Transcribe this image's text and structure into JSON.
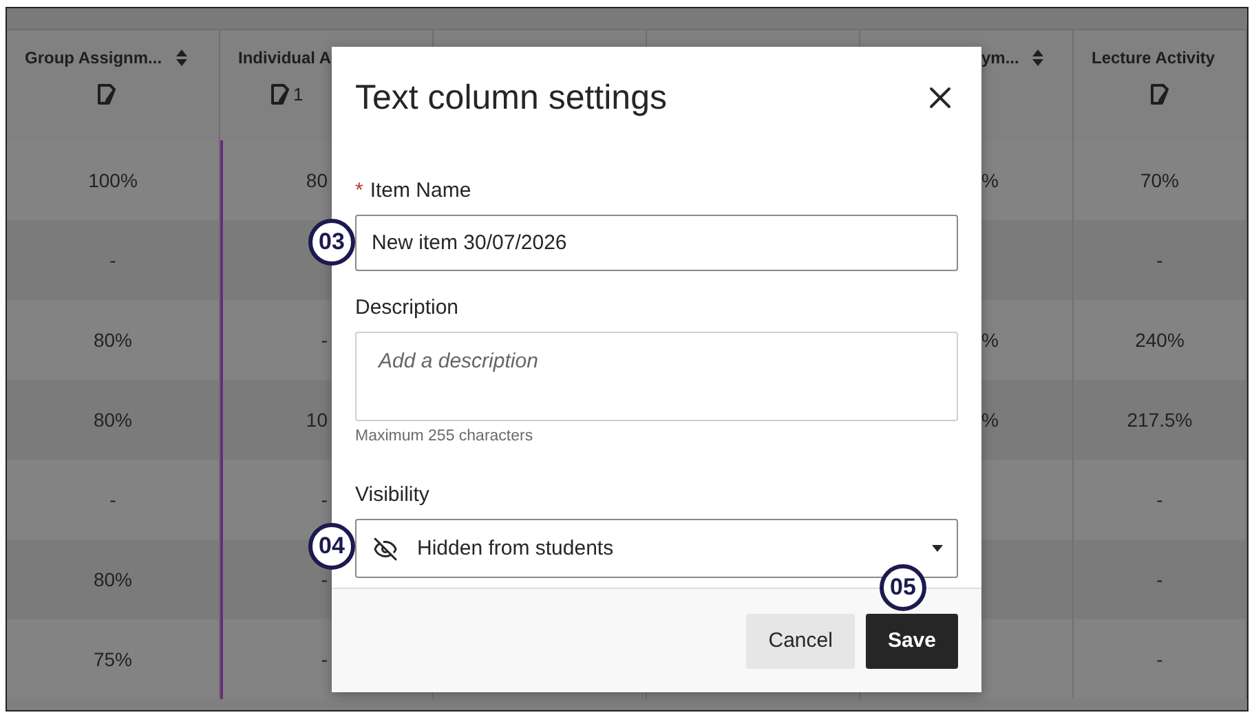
{
  "table": {
    "columns": [
      {
        "title": "Group Assignm...",
        "sortable": true
      },
      {
        "title": "Individual A",
        "sortable": false,
        "count": "1"
      },
      {
        "title": "ym...",
        "sortable": true
      },
      {
        "title": "Lecture Activity",
        "sortable": false
      }
    ],
    "rows": [
      {
        "cells": [
          "100%",
          "80",
          "%",
          "70%"
        ]
      },
      {
        "cells": [
          "-",
          null,
          null,
          "-"
        ]
      },
      {
        "cells": [
          "80%",
          "-",
          "%",
          "240%"
        ]
      },
      {
        "cells": [
          "80%",
          "10",
          "%",
          "217.5%"
        ]
      },
      {
        "cells": [
          "-",
          "-",
          null,
          "-"
        ]
      },
      {
        "cells": [
          "80%",
          "-",
          null,
          "-"
        ]
      },
      {
        "cells": [
          "75%",
          "-",
          null,
          "-"
        ]
      }
    ]
  },
  "dialog": {
    "title": "Text column settings",
    "item_name": {
      "required_mark": "*",
      "label": "Item Name",
      "value": "New item 30/07/2026",
      "callout": "03"
    },
    "description": {
      "label": "Description",
      "placeholder": "Add a description",
      "hint": "Maximum 255 characters"
    },
    "visibility": {
      "label": "Visibility",
      "value": "Hidden from students",
      "callout": "04"
    },
    "buttons": [
      {
        "label": "Cancel",
        "kind": "secondary"
      },
      {
        "label": "Save",
        "kind": "primary",
        "callout": "05"
      }
    ]
  }
}
